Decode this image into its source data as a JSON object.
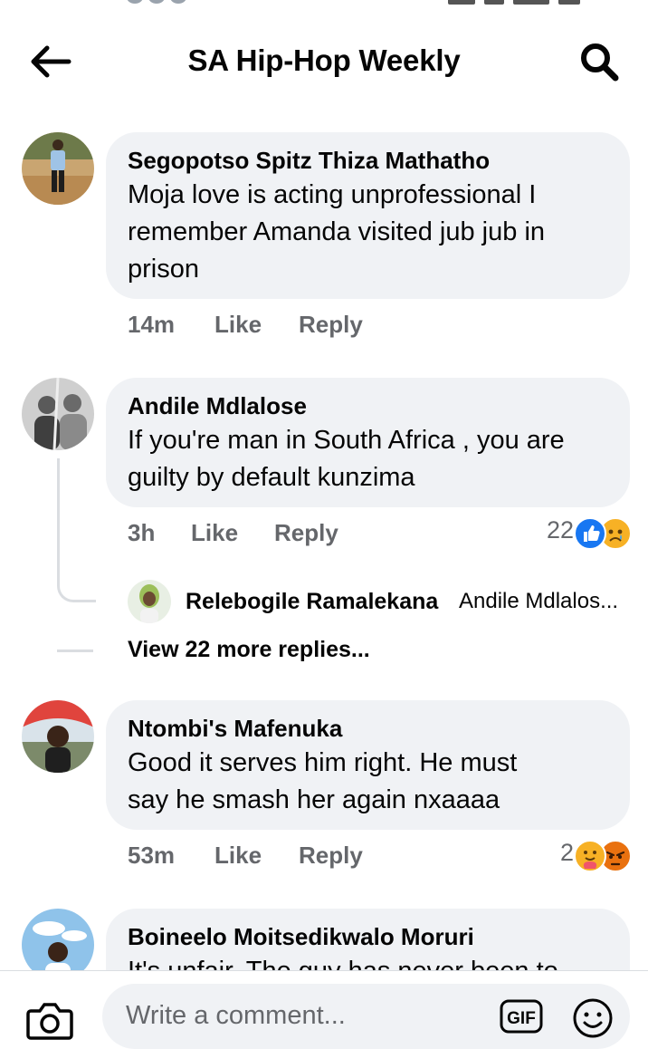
{
  "header": {
    "title": "SA Hip-Hop Weekly",
    "back_icon": "arrow-left-icon",
    "search_icon": "search-icon"
  },
  "comments": [
    {
      "author": "Segopotso Spitz Thiza Mathatho",
      "lines": [
        "Moja love is acting unprofessional I",
        "remember Amanda visited jub jub in",
        "prison"
      ],
      "time": "14m",
      "like_label": "Like",
      "reply_label": "Reply"
    },
    {
      "author": "Andile Mdlalose",
      "lines": [
        "If you're man in South Africa , you are",
        "guilty by default kunzima"
      ],
      "time": "3h",
      "like_label": "Like",
      "reply_label": "Reply",
      "reaction_count": "22",
      "reactions": [
        "like-reaction-icon",
        "sad-reaction-icon"
      ],
      "reply_preview": {
        "author": "Relebogile Ramalekana",
        "text": "Andile Mdlalos..."
      },
      "more_replies_label": "View 22 more replies..."
    },
    {
      "author": "Ntombi's Mafenuka",
      "lines": [
        "Good it serves him right. He must",
        "say he smash her again nxaaaa"
      ],
      "time": "53m",
      "like_label": "Like",
      "reply_label": "Reply",
      "reaction_count": "2",
      "reactions": [
        "care-reaction-icon",
        "angry-reaction-icon"
      ]
    },
    {
      "author": "Boineelo Moitsedikwalo Moruri",
      "lines": [
        "It's unfair. The guy has never been to"
      ]
    }
  ],
  "composer": {
    "placeholder": "Write a comment...",
    "camera_icon": "camera-icon",
    "gif_label": "GIF",
    "emoji_icon": "emoji-icon"
  },
  "colors": {
    "bubble": "#f0f2f5",
    "secondary_text": "#65676b",
    "like_blue": "#1877f2",
    "reaction_yellow": "#f7b125",
    "angry_red": "#e9710f"
  }
}
